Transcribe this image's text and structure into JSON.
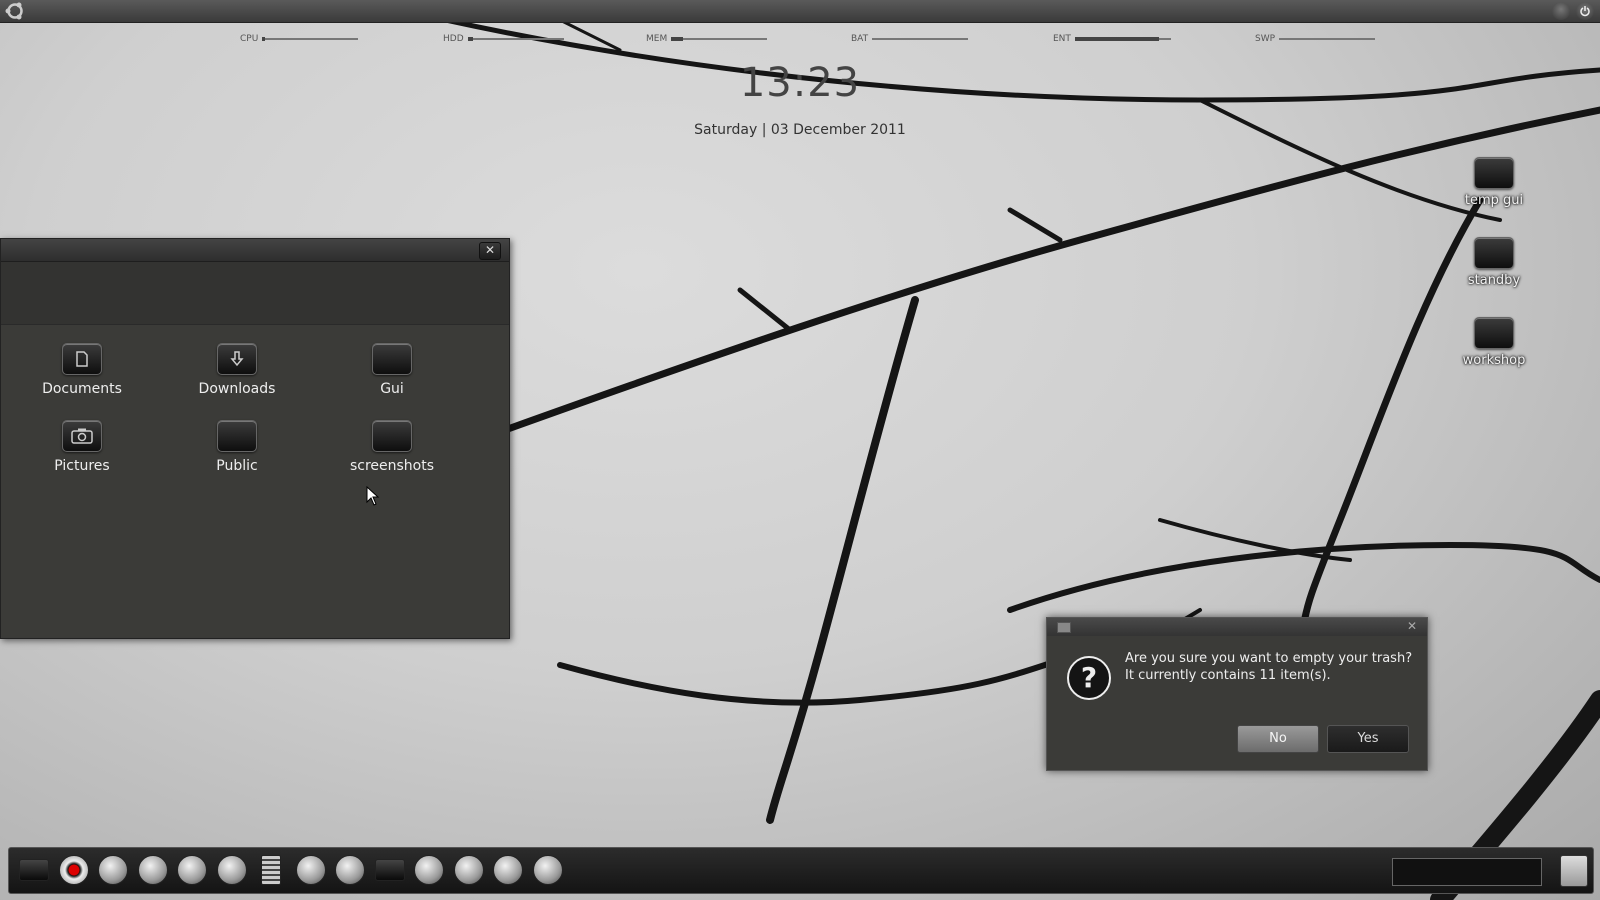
{
  "meters": [
    {
      "label": "CPU",
      "value": 0.03
    },
    {
      "label": "HDD",
      "value": 0.06
    },
    {
      "label": "MEM",
      "value": 0.12
    },
    {
      "label": "BAT",
      "value": 0.0
    },
    {
      "label": "ENT",
      "value": 0.88
    },
    {
      "label": "SWP",
      "value": 0.0
    }
  ],
  "clock": {
    "time": "13:23",
    "date": "Saturday | 03 December 2011"
  },
  "desktop_icons": [
    "temp gui",
    "standby",
    "workshop"
  ],
  "file_manager": {
    "close_label": "✕",
    "items": [
      {
        "label": "Documents",
        "icon": "document-icon"
      },
      {
        "label": "Downloads",
        "icon": "download-icon"
      },
      {
        "label": "Gui",
        "icon": "folder-icon"
      },
      {
        "label": "Pictures",
        "icon": "camera-icon"
      },
      {
        "label": "Public",
        "icon": "folder-icon"
      },
      {
        "label": "screenshots",
        "icon": "folder-icon"
      }
    ]
  },
  "dialog": {
    "line1": "Are you sure you want to empty your trash?",
    "line2": "It currently contains 11 item(s).",
    "no_label": "No",
    "yes_label": "Yes",
    "close_label": "✕"
  },
  "dock": {
    "icons": [
      "files-icon",
      "record-icon",
      "browser-icon",
      "headphones-icon",
      "settings-icon",
      "music-icon",
      "calculator-icon",
      "photo-icon",
      "camera-icon",
      "terminal-icon",
      "network-icon",
      "gimp-icon",
      "eye-icon",
      "home-icon"
    ]
  },
  "colors": {
    "dialog_bg": "#3b3b38",
    "window_bg": "#3a3a38",
    "panel_bg": "#3a3a3a"
  }
}
